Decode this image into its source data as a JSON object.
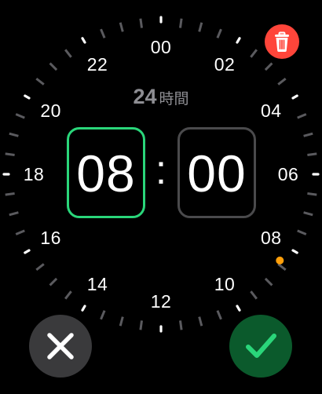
{
  "dial": {
    "hour_labels": [
      "00",
      "02",
      "04",
      "06",
      "08",
      "10",
      "12",
      "14",
      "16",
      "18",
      "20",
      "22"
    ],
    "selected_hour": "08",
    "indicator_color": "#ff9f0a"
  },
  "mode": {
    "number": "24",
    "unit": "時間"
  },
  "time": {
    "hours": "08",
    "separator": ":",
    "minutes": "00"
  },
  "colors": {
    "active_field_border": "#2ad67a",
    "inactive_field_border": "#4a4a4c",
    "delete_button": "#ff453a",
    "cancel_button": "#3a3a3c",
    "confirm_button": "#0b5a2c",
    "confirm_check": "#2ad67a"
  },
  "icons": {
    "delete": "trash-icon",
    "cancel": "close-icon",
    "confirm": "checkmark-icon"
  }
}
